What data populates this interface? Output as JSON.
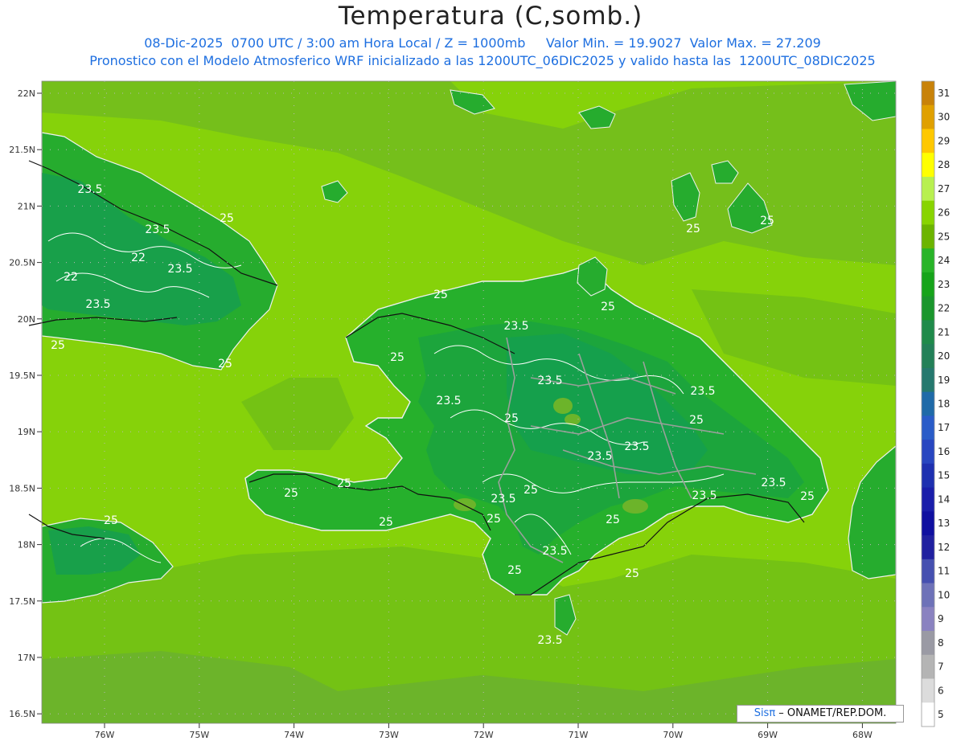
{
  "header": {
    "title": "Temperatura (C,somb.)",
    "line1": "08-Dic-2025  0700 UTC / 3:00 am Hora Local / Z = 1000mb     Valor Min. = 19.9027  Valor Max. = 27.209",
    "line2": "Pronostico con el Modelo Atmosferico WRF inicializado a las 1200UTC_06DIC2025 y valido hasta las  1200UTC_08DIC2025"
  },
  "axes": {
    "lat_labels": [
      "22N",
      "21.5N",
      "21N",
      "20.5N",
      "20N",
      "19.5N",
      "19N",
      "18.5N",
      "18N",
      "17.5N",
      "17N",
      "16.5N"
    ],
    "lon_labels": [
      "76W",
      "75W",
      "74W",
      "73W",
      "72W",
      "71W",
      "70W",
      "69W",
      "68W"
    ]
  },
  "contour_labels": [
    "23.5",
    "23.5",
    "22",
    "22",
    "23.5",
    "23.5",
    "25",
    "25",
    "25",
    "25",
    "23.5",
    "25",
    "23.5",
    "23.5",
    "25",
    "23.5",
    "25",
    "23.5",
    "23.5",
    "23.5",
    "25",
    "23.5",
    "25",
    "23.5",
    "25",
    "25",
    "25",
    "25",
    "25",
    "23.5",
    "25",
    "25",
    "23.5",
    "25",
    "25",
    "25",
    "25"
  ],
  "colorbar": {
    "labels": [
      "31",
      "30",
      "29",
      "28",
      "27",
      "26",
      "25",
      "24",
      "23",
      "22",
      "21",
      "20",
      "19",
      "18",
      "17",
      "16",
      "15",
      "14",
      "13",
      "12",
      "11",
      "10",
      "9",
      "8",
      "7",
      "6",
      "5"
    ],
    "colors": [
      "#c8820a",
      "#e0a000",
      "#ffc800",
      "#ffff00",
      "#b8f050",
      "#88d400",
      "#6cb400",
      "#28b428",
      "#16a41a",
      "#1a962c",
      "#1f8a4a",
      "#238058",
      "#25786e",
      "#1f6aa8",
      "#2a5cc8",
      "#2846c0",
      "#1e30b0",
      "#1a1eaa",
      "#1010a0",
      "#2020a0",
      "#4650b0",
      "#6e72b8",
      "#8a82c0",
      "#9a9aa4",
      "#b4b4b4",
      "#dcdcdc",
      "#ffffff"
    ]
  },
  "credit": {
    "brand": "Sisπ",
    "org": " – ONAMET/REP.DOM."
  },
  "palette": {
    "sea": "#86d20a",
    "sea_warm": "#6cb42a",
    "land_mid": "#26b02c",
    "land_cool": "#16a24a"
  }
}
